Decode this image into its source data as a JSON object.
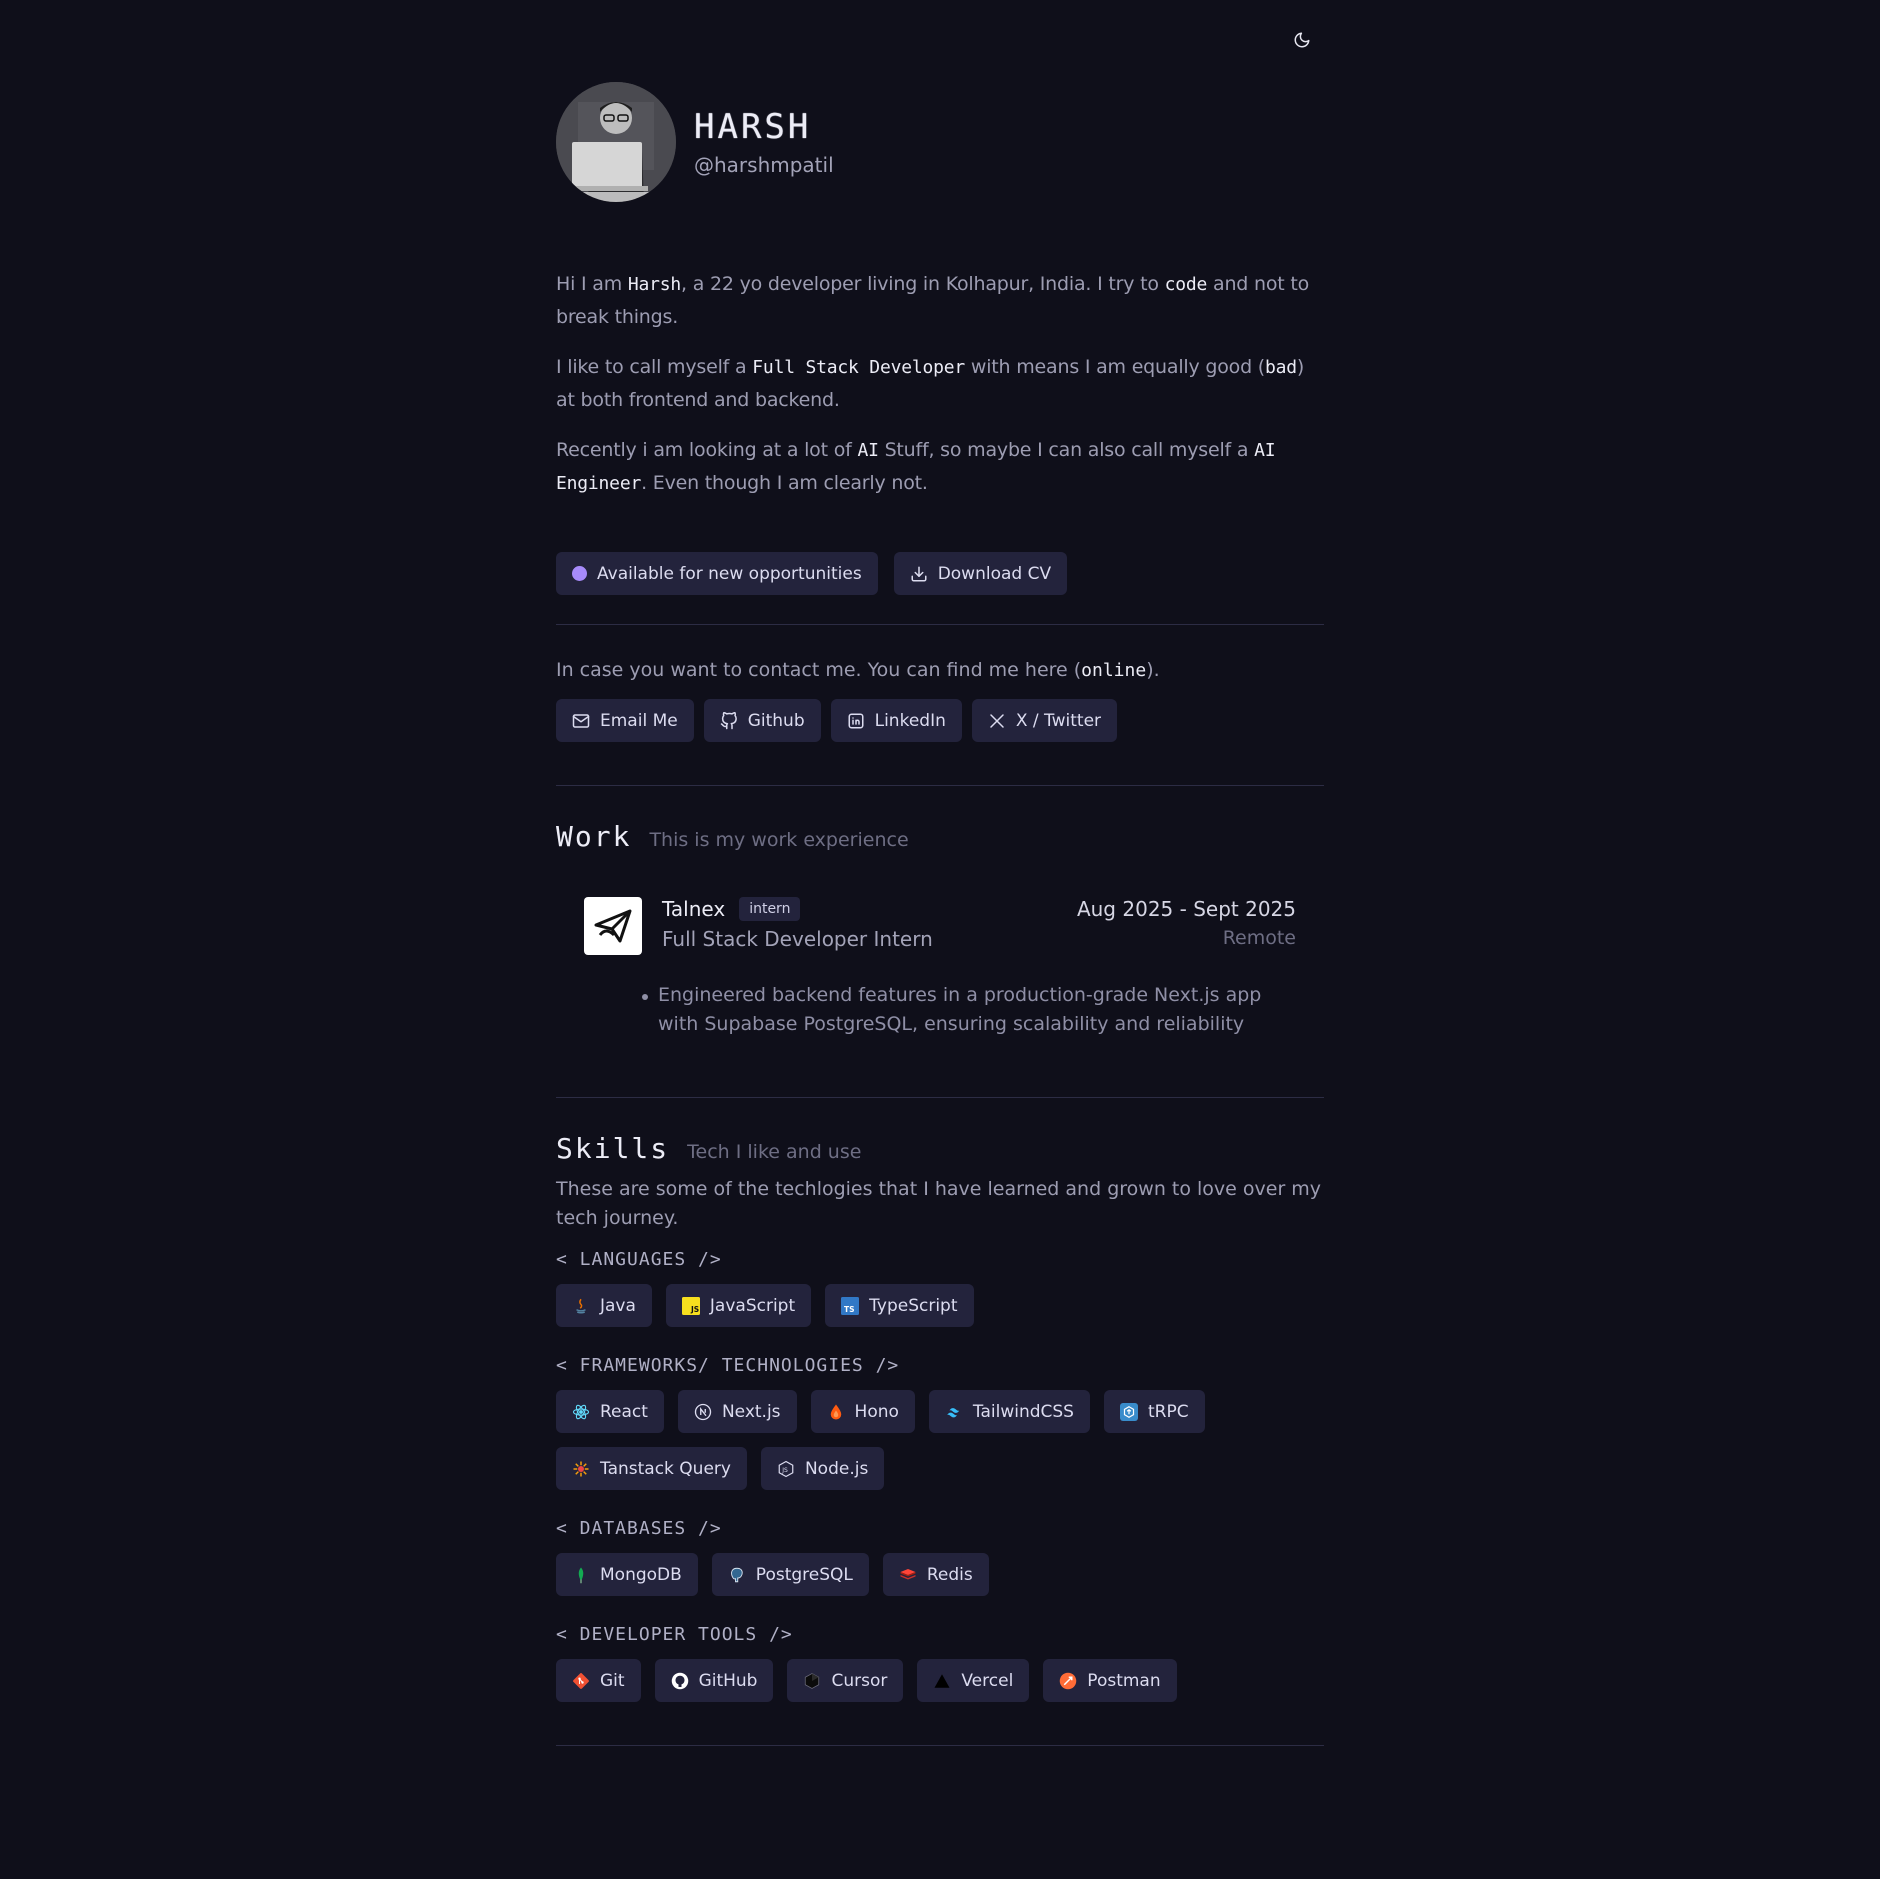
{
  "profile": {
    "name": "HARSH",
    "handle": "@harshmpatil"
  },
  "bio": {
    "p1": {
      "t1": "Hi I am ",
      "m1": "Harsh",
      "t2": ", a 22 yo developer living in Kolhapur, India. I try to ",
      "m2": "code",
      "t3": " and not to break things."
    },
    "p2": {
      "t1": "I like to call myself a ",
      "m1": "Full Stack Developer",
      "t2": " with means I am equally good (",
      "m2": "bad",
      "t3": ") at both frontend and backend."
    },
    "p3": {
      "t1": "Recently i am looking at a lot of ",
      "m1": "AI",
      "t2": " Stuff, so maybe I can also call myself a ",
      "m2": "AI Engineer",
      "t3": ". Even though I am clearly not."
    }
  },
  "actions": {
    "available": "Available for new opportunities",
    "download_cv": "Download CV"
  },
  "contact": {
    "t1": "In case you want to contact me. You can find me here (",
    "m1": "online",
    "t2": ").",
    "email": "Email Me",
    "github": "Github",
    "linkedin": "LinkedIn",
    "twitter": "X / Twitter"
  },
  "work": {
    "title": "Work",
    "subtitle": "This is my work experience",
    "jobs": [
      {
        "company": "Talnex",
        "tag": "intern",
        "role": "Full Stack Developer Intern",
        "dates": "Aug 2025 - Sept 2025",
        "location": "Remote",
        "bullets": [
          "Engineered backend features in a production-grade Next.js app with Supabase PostgreSQL, ensuring scalability and reliability"
        ]
      }
    ]
  },
  "skills": {
    "title": "Skills",
    "subtitle": "Tech I like and use",
    "description": "These are some of the techlogies that I have learned and grown to love over my tech journey.",
    "groups": [
      {
        "label": "< LANGUAGES />",
        "items": [
          "Java",
          "JavaScript",
          "TypeScript"
        ],
        "icons": [
          "java-icon",
          "javascript-icon",
          "typescript-icon"
        ]
      },
      {
        "label": "< FRAMEWORKS/ TECHNOLOGIES />",
        "items": [
          "React",
          "Next.js",
          "Hono",
          "TailwindCSS",
          "tRPC",
          "Tanstack Query",
          "Node.js"
        ],
        "icons": [
          "react-icon",
          "nextjs-icon",
          "hono-icon",
          "tailwind-icon",
          "trpc-icon",
          "tanstack-icon",
          "nodejs-icon"
        ]
      },
      {
        "label": "< DATABASES />",
        "items": [
          "MongoDB",
          "PostgreSQL",
          "Redis"
        ],
        "icons": [
          "mongodb-icon",
          "postgresql-icon",
          "redis-icon"
        ]
      },
      {
        "label": "< DEVELOPER TOOLS />",
        "items": [
          "Git",
          "GitHub",
          "Cursor",
          "Vercel",
          "Postman"
        ],
        "icons": [
          "git-icon",
          "github-icon",
          "cursor-icon",
          "vercel-icon",
          "postman-icon"
        ]
      }
    ]
  },
  "colors": {
    "background": "#0f0f1a",
    "chip": "#23233c",
    "accent_dot": "#a78bfa",
    "divider": "#2c2c44"
  }
}
